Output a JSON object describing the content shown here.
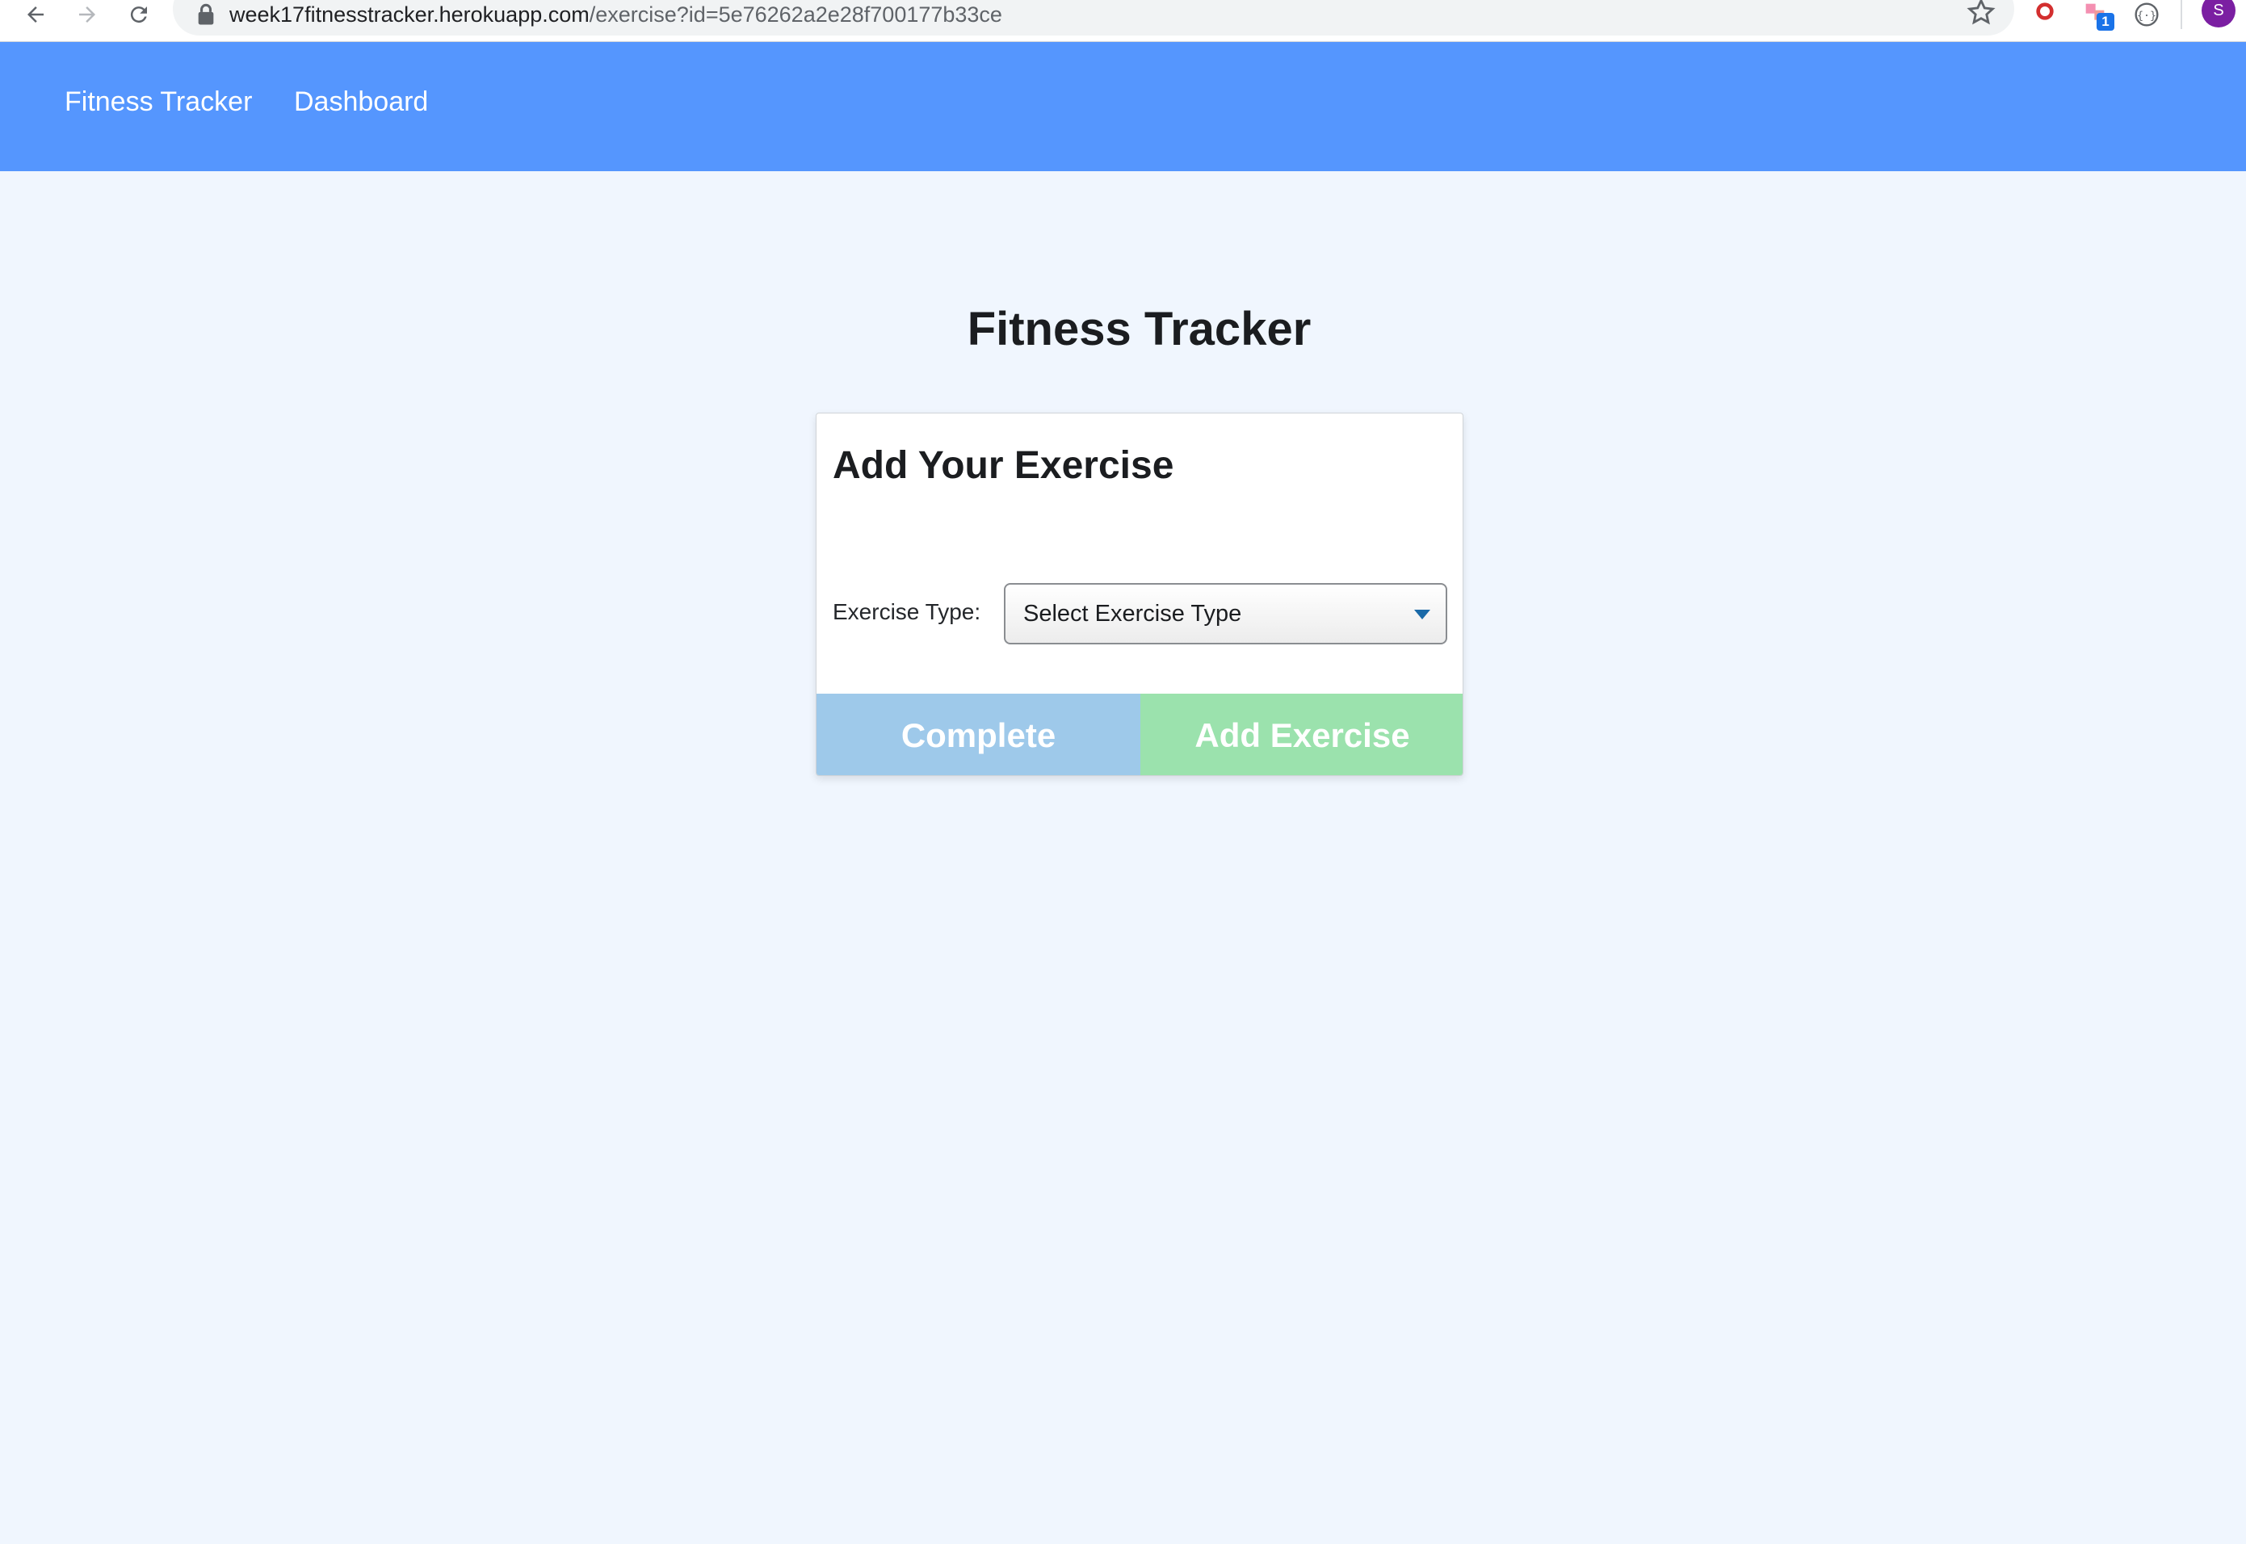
{
  "browser": {
    "url_host": "week17fitnesstracker.herokuapp.com",
    "url_path": "/exercise?id=5e76262a2e28f700177b33ce",
    "extension_badge": "1",
    "profile_initial": "S"
  },
  "navbar": {
    "brand": "Fitness Tracker",
    "links": [
      "Dashboard"
    ]
  },
  "page": {
    "title": "Fitness Tracker"
  },
  "card": {
    "title": "Add Your Exercise",
    "exercise_type_label": "Exercise Type:",
    "exercise_type_select": {
      "selected": "Select Exercise Type"
    },
    "buttons": {
      "complete": "Complete",
      "add_exercise": "Add Exercise"
    }
  },
  "colors": {
    "navbar": "#5596fe",
    "background": "#f0f6fe",
    "complete_button": "#9ec9ea",
    "add_button": "#9be2ad",
    "caret": "#1a6aa8"
  }
}
